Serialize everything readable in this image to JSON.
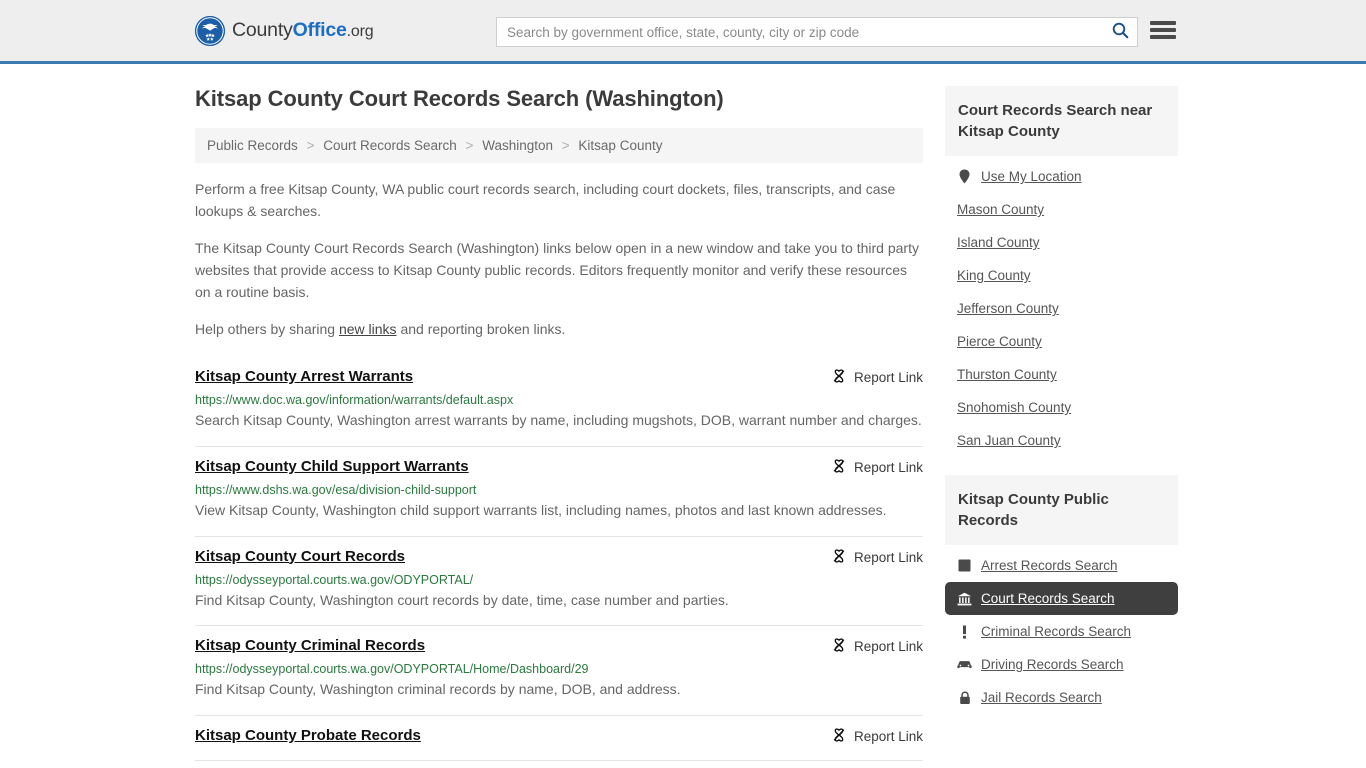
{
  "header": {
    "brand": {
      "part1": "County",
      "part2": "Office",
      "part3": ".org",
      "logo_icon": "eagle-seal-icon"
    },
    "search": {
      "placeholder": "Search by government office, state, county, city or zip code",
      "value": "",
      "search_icon": "search-icon"
    },
    "menu_icon": "hamburger-menu-icon"
  },
  "main": {
    "title": "Kitsap County Court Records Search (Washington)",
    "breadcrumb": [
      {
        "label": "Public Records"
      },
      {
        "label": "Court Records Search"
      },
      {
        "label": "Washington"
      },
      {
        "label": "Kitsap County"
      }
    ],
    "breadcrumb_separator": ">",
    "intro": [
      "Perform a free Kitsap County, WA public court records search, including court dockets, files, transcripts, and case lookups & searches.",
      "The Kitsap County Court Records Search (Washington) links below open in a new window and take you to third party websites that provide access to Kitsap County public records. Editors frequently monitor and verify these resources on a routine basis."
    ],
    "help_prefix": "Help others by sharing ",
    "help_link": "new links",
    "help_suffix": " and reporting broken links.",
    "report_link_label": "Report Link",
    "report_link_icon": "broken-link-icon",
    "results": [
      {
        "title": "Kitsap County Arrest Warrants",
        "url": "https://www.doc.wa.gov/information/warrants/default.aspx",
        "description": "Search Kitsap County, Washington arrest warrants by name, including mugshots, DOB, warrant number and charges."
      },
      {
        "title": "Kitsap County Child Support Warrants",
        "url": "https://www.dshs.wa.gov/esa/division-child-support",
        "description": "View Kitsap County, Washington child support warrants list, including names, photos and last known addresses."
      },
      {
        "title": "Kitsap County Court Records",
        "url": "https://odysseyportal.courts.wa.gov/ODYPORTAL/",
        "description": "Find Kitsap County, Washington court records by date, time, case number and parties."
      },
      {
        "title": "Kitsap County Criminal Records",
        "url": "https://odysseyportal.courts.wa.gov/ODYPORTAL/Home/Dashboard/29",
        "description": "Find Kitsap County, Washington criminal records by name, DOB, and address."
      },
      {
        "title": "Kitsap County Probate Records",
        "url": "",
        "description": ""
      }
    ]
  },
  "sidebar": {
    "nearby": {
      "heading": "Court Records Search near Kitsap County",
      "items": [
        {
          "label": "Use My Location",
          "icon": "map-pin-icon"
        },
        {
          "label": "Mason County",
          "icon": ""
        },
        {
          "label": "Island County",
          "icon": ""
        },
        {
          "label": "King County",
          "icon": ""
        },
        {
          "label": "Jefferson County",
          "icon": ""
        },
        {
          "label": "Pierce County",
          "icon": ""
        },
        {
          "label": "Thurston County",
          "icon": ""
        },
        {
          "label": "Snohomish County",
          "icon": ""
        },
        {
          "label": "San Juan County",
          "icon": ""
        }
      ]
    },
    "public_records": {
      "heading": "Kitsap County Public Records",
      "items": [
        {
          "label": "Arrest Records Search",
          "icon": "fingerprint-square-icon",
          "active": false
        },
        {
          "label": "Court Records Search",
          "icon": "courthouse-icon",
          "active": true
        },
        {
          "label": "Criminal Records Search",
          "icon": "exclamation-icon",
          "active": false
        },
        {
          "label": "Driving Records Search",
          "icon": "car-icon",
          "active": false
        },
        {
          "label": "Jail Records Search",
          "icon": "lock-icon",
          "active": false
        }
      ]
    }
  },
  "colors": {
    "header_bg": "#eeeeee",
    "header_border": "#3a7ab0",
    "brand_blue": "#1c6fc4",
    "url_green": "#2a7a3e",
    "panel_bg": "#f5f5f5",
    "active_bg": "#3f3f3f"
  }
}
